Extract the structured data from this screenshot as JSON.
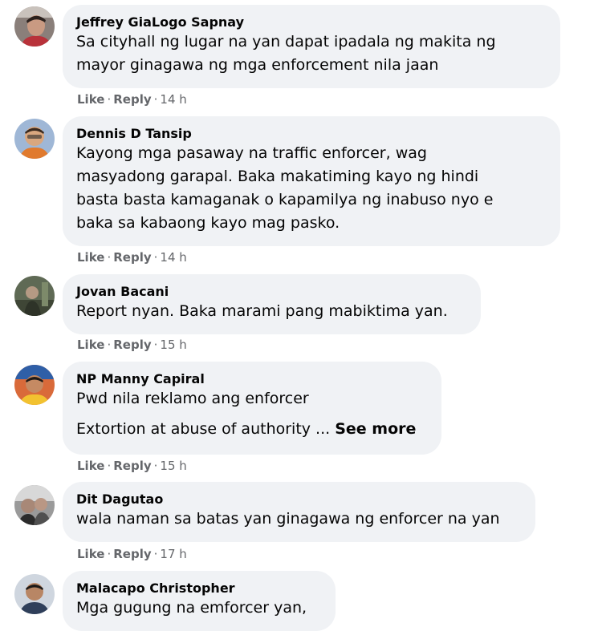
{
  "comments": [
    {
      "author": "Jeffrey GiaLogo Sapnay",
      "lines": [
        "Sa cityhall ng lugar na yan dapat ipadala ng makita ng",
        "mayor ginagawa ng mga enforcement nila jaan"
      ],
      "time": "14 h"
    },
    {
      "author": "Dennis D Tansip",
      "lines": [
        "Kayong mga pasaway na traffic enforcer, wag",
        "masyadong garapal. Baka makatiming kayo ng hindi",
        "basta basta kamaganak o kapamilya ng inabuso nyo e",
        "baka sa kabaong kayo mag pasko."
      ],
      "time": "14 h"
    },
    {
      "author": "Jovan Bacani",
      "lines": [
        "Report nyan. Baka marami pang mabiktima yan."
      ],
      "time": "15 h"
    },
    {
      "author": "NP Manny Capiral",
      "lines": [
        "Pwd nila reklamo ang enforcer",
        "Extortion at abuse of authority ..."
      ],
      "see_more": "See more",
      "time": "15 h"
    },
    {
      "author": "Dit Dagutao",
      "lines": [
        "wala naman sa batas yan ginagawa ng enforcer na yan"
      ],
      "time": "17 h"
    },
    {
      "author": "Malacapo Christopher",
      "lines": [
        "Mga gugung na emforcer yan,"
      ]
    }
  ],
  "action_labels": {
    "like": "Like",
    "reply": "Reply",
    "separator": "·"
  },
  "colors": {
    "bubble_background": "#f0f2f5",
    "text": "#050505",
    "secondary_text": "#65676b"
  }
}
